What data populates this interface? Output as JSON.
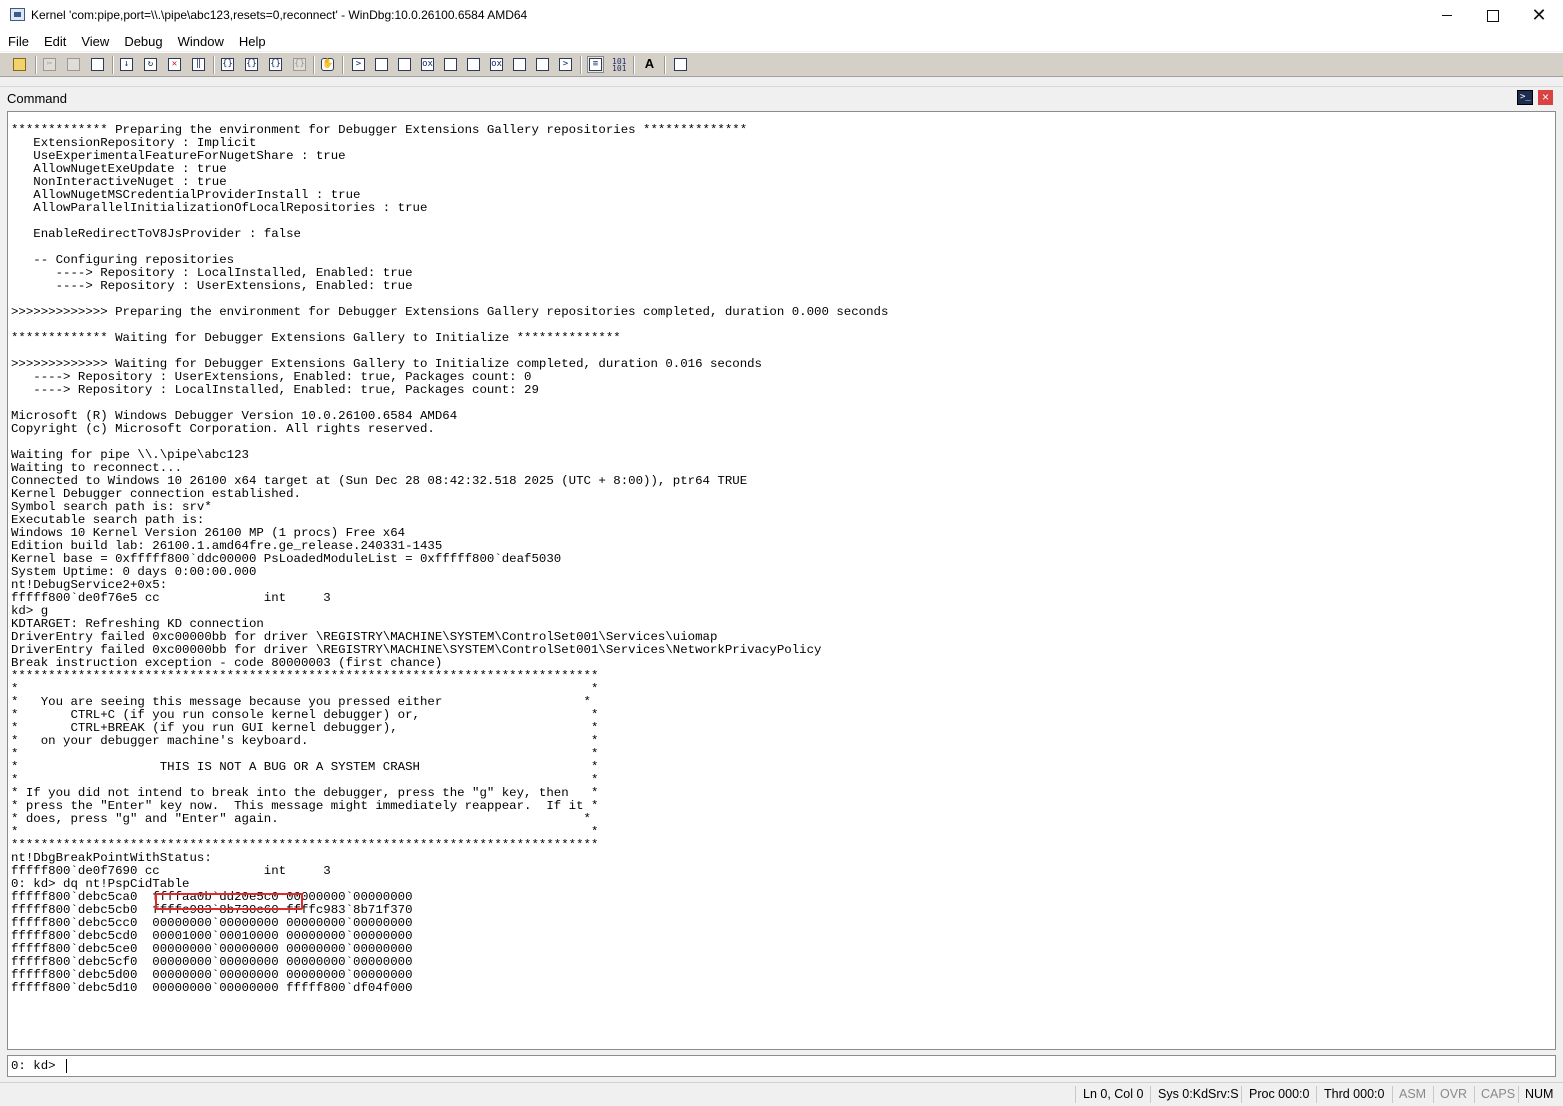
{
  "window": {
    "title": "Kernel 'com:pipe,port=\\\\.\\pipe\\abc123,resets=0,reconnect' - WinDbg:10.0.26100.6584 AMD64",
    "minimize": "—",
    "maximize": "",
    "close": "✕"
  },
  "menu": [
    "File",
    "Edit",
    "View",
    "Debug",
    "Window",
    "Help"
  ],
  "toolbar": {
    "icons": [
      "open-icon",
      "cut-icon",
      "copy-icon",
      "paste-icon",
      "go-icon",
      "restart-icon",
      "stop-debugging-icon",
      "break-icon",
      "step-into-icon",
      "step-over-icon",
      "step-out-icon",
      "run-to-cursor-icon",
      "insert-breakpoint-icon",
      "command-window-icon",
      "watch-window-icon",
      "locals-window-icon",
      "registers-window-icon",
      "memory-window-icon",
      "call-stack-icon",
      "disassembly-icon",
      "scratch-pad-icon",
      "processes-threads-icon",
      "source-mode-icon",
      "hex-mode-icon",
      "font-icon",
      "options-icon"
    ]
  },
  "pane": {
    "title": "Command",
    "close": "×"
  },
  "output": {
    "lines": [
      "************* Preparing the environment for Debugger Extensions Gallery repositories **************",
      "   ExtensionRepository : Implicit",
      "   UseExperimentalFeatureForNugetShare : true",
      "   AllowNugetExeUpdate : true",
      "   NonInteractiveNuget : true",
      "   AllowNugetMSCredentialProviderInstall : true",
      "   AllowParallelInitializationOfLocalRepositories : true",
      "",
      "   EnableRedirectToV8JsProvider : false",
      "",
      "   -- Configuring repositories",
      "      ----> Repository : LocalInstalled, Enabled: true",
      "      ----> Repository : UserExtensions, Enabled: true",
      "",
      ">>>>>>>>>>>>> Preparing the environment for Debugger Extensions Gallery repositories completed, duration 0.000 seconds",
      "",
      "************* Waiting for Debugger Extensions Gallery to Initialize **************",
      "",
      ">>>>>>>>>>>>> Waiting for Debugger Extensions Gallery to Initialize completed, duration 0.016 seconds",
      "   ----> Repository : UserExtensions, Enabled: true, Packages count: 0",
      "   ----> Repository : LocalInstalled, Enabled: true, Packages count: 29",
      "",
      "Microsoft (R) Windows Debugger Version 10.0.26100.6584 AMD64",
      "Copyright (c) Microsoft Corporation. All rights reserved.",
      "",
      "Waiting for pipe \\\\.\\pipe\\abc123",
      "Waiting to reconnect...",
      "Connected to Windows 10 26100 x64 target at (Sun Dec 28 08:42:32.518 2025 (UTC + 8:00)), ptr64 TRUE",
      "Kernel Debugger connection established.",
      "Symbol search path is: srv*",
      "Executable search path is:",
      "Windows 10 Kernel Version 26100 MP (1 procs) Free x64",
      "Edition build lab: 26100.1.amd64fre.ge_release.240331-1435",
      "Kernel base = 0xfffff800`ddc00000 PsLoadedModuleList = 0xfffff800`deaf5030",
      "System Uptime: 0 days 0:00:00.000",
      "nt!DebugService2+0x5:",
      "fffff800`de0f76e5 cc              int     3",
      "kd> g",
      "KDTARGET: Refreshing KD connection",
      "DriverEntry failed 0xc00000bb for driver \\REGISTRY\\MACHINE\\SYSTEM\\ControlSet001\\Services\\uiomap",
      "DriverEntry failed 0xc00000bb for driver \\REGISTRY\\MACHINE\\SYSTEM\\ControlSet001\\Services\\NetworkPrivacyPolicy",
      "Break instruction exception - code 80000003 (first chance)",
      "*******************************************************************************",
      "*                                                                             *",
      "*   You are seeing this message because you pressed either                   *",
      "*       CTRL+C (if you run console kernel debugger) or,                       *",
      "*       CTRL+BREAK (if you run GUI kernel debugger),                          *",
      "*   on your debugger machine's keyboard.                                      *",
      "*                                                                             *",
      "*                   THIS IS NOT A BUG OR A SYSTEM CRASH                       *",
      "*                                                                             *",
      "* If you did not intend to break into the debugger, press the \"g\" key, then   *",
      "* press the \"Enter\" key now.  This message might immediately reappear.  If it *",
      "* does, press \"g\" and \"Enter\" again.                                         *",
      "*                                                                             *",
      "*******************************************************************************",
      "nt!DbgBreakPointWithStatus:",
      "fffff800`de0f7690 cc              int     3",
      "0: kd> dq nt!PspCidTable",
      "fffff800`debc5ca0  ffffaa0b`dd20e5c0 00000000`00000000",
      "fffff800`debc5cb0  ffffc983`8b730c60 ffffc983`8b71f370",
      "fffff800`debc5cc0  00000000`00000000 00000000`00000000",
      "fffff800`debc5cd0  00001000`00010000 00000000`00000000",
      "fffff800`debc5ce0  00000000`00000000 00000000`00000000",
      "fffff800`debc5cf0  00000000`00000000 00000000`00000000",
      "fffff800`debc5d00  00000000`00000000 00000000`00000000",
      "fffff800`debc5d10  00000000`00000000 fffff800`df04f000"
    ]
  },
  "input": {
    "prompt": "0: kd>",
    "value": ""
  },
  "status": {
    "position": "Ln 0, Col 0",
    "sys": "Sys 0:KdSrv:S",
    "proc": "Proc 000:0",
    "thrd": "Thrd 000:0",
    "asm": "ASM",
    "ovr": "OVR",
    "caps": "CAPS",
    "num": "NUM"
  },
  "colors": {
    "highlight": "#e02b2b",
    "toolbar": "#d4d0c8"
  }
}
